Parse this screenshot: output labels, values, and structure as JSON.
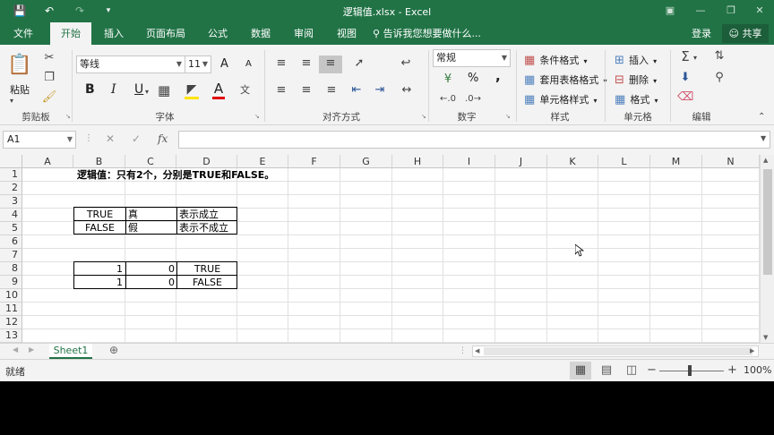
{
  "window": {
    "title": "逻辑值.xlsx - Excel"
  },
  "tabs": [
    {
      "label": "文件"
    },
    {
      "label": "开始"
    },
    {
      "label": "插入"
    },
    {
      "label": "页面布局"
    },
    {
      "label": "公式"
    },
    {
      "label": "数据"
    },
    {
      "label": "审阅"
    },
    {
      "label": "视图"
    }
  ],
  "tellme": "告诉我您想要做什么...",
  "account": {
    "login": "登录",
    "share": "共享"
  },
  "ribbon": {
    "clipboard": {
      "paste": "粘贴",
      "label": "剪贴板"
    },
    "font": {
      "name": "等线",
      "size": "11",
      "label": "字体",
      "bold": "B",
      "italic": "I",
      "underline": "U",
      "grow": "A",
      "shrink": "A"
    },
    "alignment": {
      "label": "对齐方式"
    },
    "number": {
      "format": "常规",
      "label": "数字",
      "percent": "%",
      "comma": ","
    },
    "styles": {
      "conditional": "条件格式",
      "table": "套用表格格式",
      "cell": "单元格样式",
      "label": "样式"
    },
    "cells": {
      "insert": "插入",
      "delete": "删除",
      "format": "格式",
      "label": "单元格"
    },
    "editing": {
      "label": "编辑"
    }
  },
  "formula_bar": {
    "name_box": "A1",
    "fx": "fx",
    "content": ""
  },
  "columns": [
    "A",
    "B",
    "C",
    "D",
    "E",
    "F",
    "G",
    "H",
    "I",
    "J",
    "K",
    "L",
    "M",
    "N"
  ],
  "rows": [
    "1",
    "2",
    "3",
    "4",
    "5",
    "6",
    "7",
    "8",
    "9",
    "10",
    "11",
    "12",
    "13"
  ],
  "cells": {
    "B1": "逻辑值：只有2个，分别是TRUE和FALSE。",
    "B4": "TRUE",
    "C4": "真",
    "D4": "表示成立",
    "B5": "FALSE",
    "C5": "假",
    "D5": "表示不成立",
    "B8": "1",
    "C8": "0",
    "D8": "TRUE",
    "B9": "1",
    "C9": "0",
    "D9": "FALSE"
  },
  "sheets": [
    {
      "name": "Sheet1"
    }
  ],
  "status": {
    "ready": "就绪",
    "zoom": "100%",
    "zoom_minus": "−",
    "zoom_plus": "+"
  },
  "colors": {
    "accent": "#217346"
  }
}
